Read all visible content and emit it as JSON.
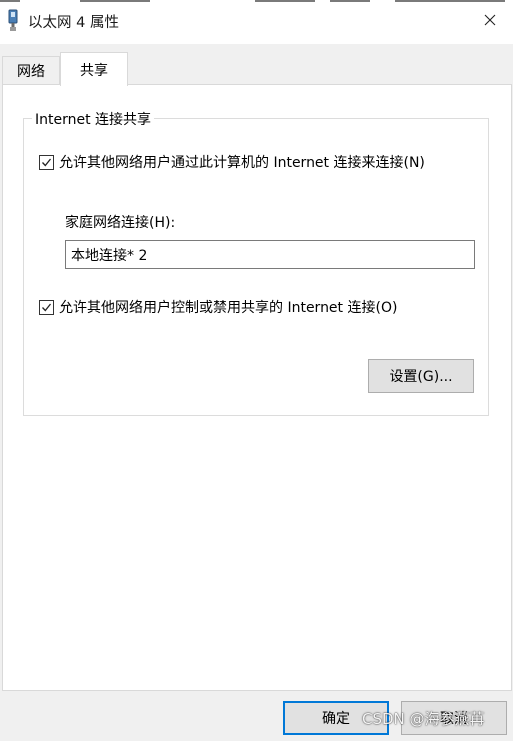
{
  "window": {
    "title": "以太网 4 属性"
  },
  "tabs": [
    {
      "label": "网络",
      "selected": false
    },
    {
      "label": "共享",
      "selected": true
    }
  ],
  "sharing": {
    "group_title": "Internet 连接共享",
    "allow_connect_label": "允许其他网络用户通过此计算机的 Internet 连接来连接(N)",
    "allow_connect_checked": true,
    "home_network_label": "家庭网络连接(H):",
    "home_network_value": "本地连接* 2",
    "allow_control_label": "允许其他网络用户控制或禁用共享的 Internet 连接(O)",
    "allow_control_checked": true,
    "settings_button": "设置(G)..."
  },
  "footer": {
    "ok_button": "确定",
    "cancel_button": "取消"
  },
  "watermark": "CSDN @海参燕苒",
  "colors": {
    "dialog_bg": "#f0f0f0",
    "tab_page_bg": "#ffffff",
    "default_button_border": "#0078d7",
    "button_bg": "#e1e1e1"
  }
}
